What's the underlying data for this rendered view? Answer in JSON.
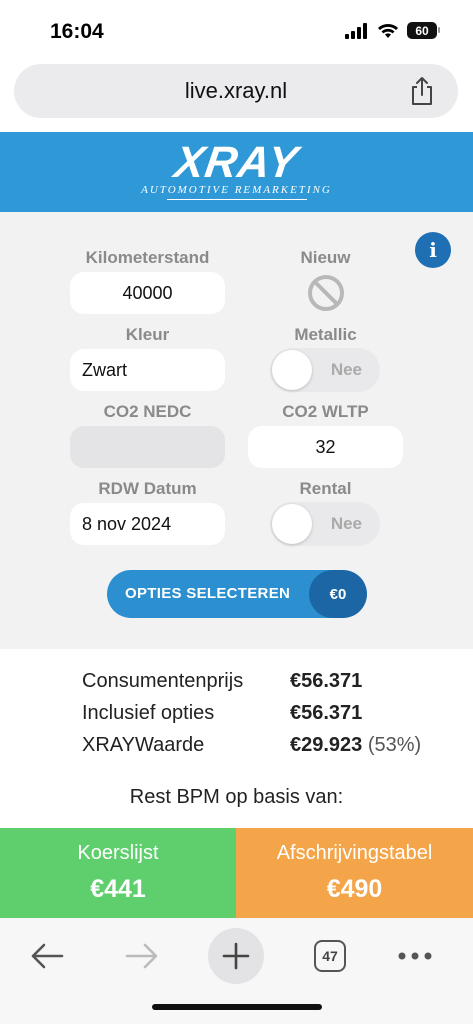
{
  "status_bar": {
    "time": "16:04",
    "battery": "60"
  },
  "browser": {
    "url": "live.xray.nl",
    "tab_count": "47"
  },
  "header": {
    "logo_main": "XRAY",
    "logo_sub": "AUTOMOTIVE REMARKETING"
  },
  "form": {
    "kilometerstand_label": "Kilometerstand",
    "kilometerstand_value": "40000",
    "nieuw_label": "Nieuw",
    "kleur_label": "Kleur",
    "kleur_value": "Zwart",
    "metallic_label": "Metallic",
    "metallic_value": "Nee",
    "co2_nedc_label": "CO2 NEDC",
    "co2_nedc_value": "",
    "co2_wltp_label": "CO2 WLTP",
    "co2_wltp_value": "32",
    "rdw_label": "RDW Datum",
    "rdw_value": "8 nov 2024",
    "rental_label": "Rental",
    "rental_value": "Nee",
    "options_label": "OPTIES SELECTEREN",
    "options_price": "€0"
  },
  "results": {
    "rows": [
      {
        "label": "Consumentenprijs",
        "value": "€56.371",
        "extra": ""
      },
      {
        "label": "Inclusief opties",
        "value": "€56.371",
        "extra": ""
      },
      {
        "label": "XRAYWaarde",
        "value": "€29.923",
        "extra": "(53%)"
      }
    ],
    "bpm_title": "Rest BPM op basis van:",
    "koerslijst_label": "Koerslijst",
    "koerslijst_value": "€441",
    "afschrijving_label": "Afschrijvingstabel",
    "afschrijving_value": "€490"
  },
  "colors": {
    "brand_blue": "#2f98d6",
    "green": "#5fcf6e",
    "orange": "#f4a54a"
  },
  "icons": [
    "signal-icon",
    "wifi-icon",
    "battery-icon",
    "share-icon",
    "info-icon",
    "no-icon",
    "back-icon",
    "forward-icon",
    "plus-icon",
    "tabs-icon",
    "more-icon"
  ]
}
